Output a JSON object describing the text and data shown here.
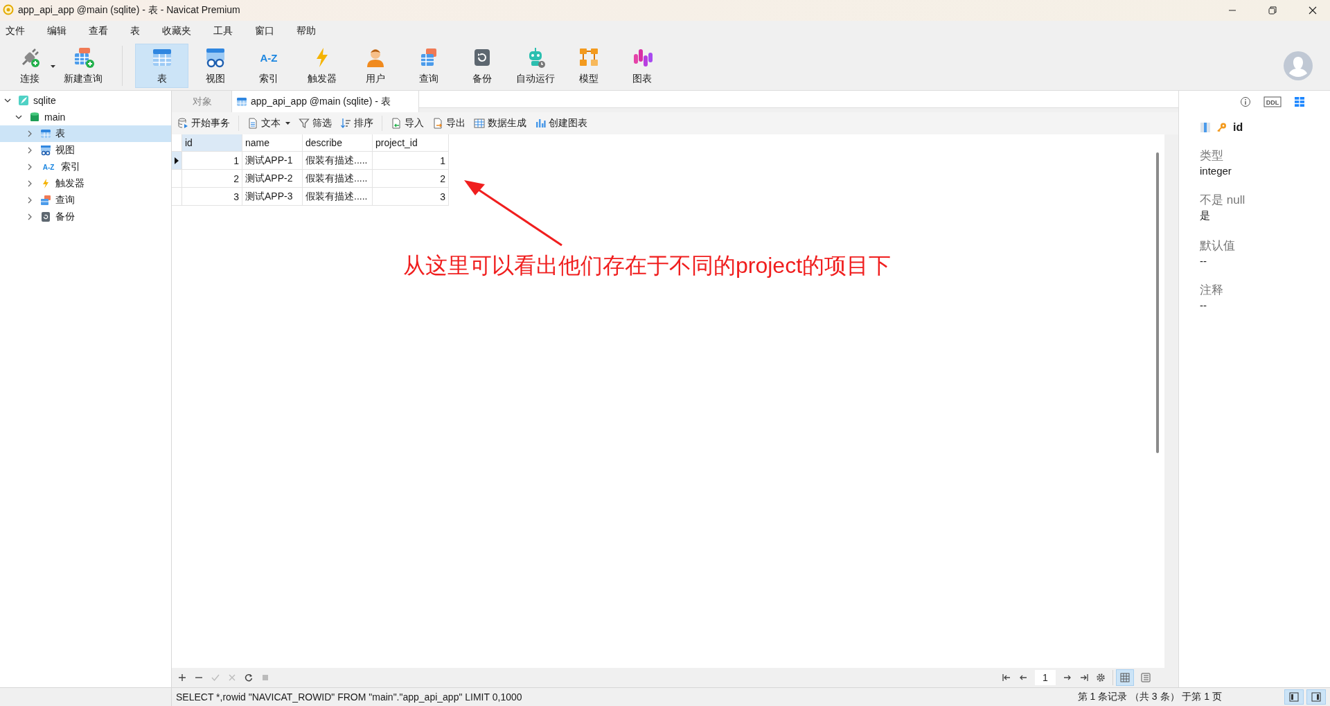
{
  "window": {
    "title": "app_api_app @main (sqlite) - 表 - Navicat Premium"
  },
  "menu": [
    "文件",
    "编辑",
    "查看",
    "表",
    "收藏夹",
    "工具",
    "窗口",
    "帮助"
  ],
  "toolbar": [
    {
      "label": "连接",
      "kind": "connect",
      "selected": false,
      "dropdown": true
    },
    {
      "label": "新建查询",
      "kind": "new-query",
      "selected": false,
      "dropdown": false
    },
    {
      "label": "表",
      "kind": "table",
      "selected": true,
      "dropdown": false
    },
    {
      "label": "视图",
      "kind": "view",
      "selected": false,
      "dropdown": false
    },
    {
      "label": "索引",
      "kind": "index",
      "selected": false,
      "dropdown": false,
      "icon_text": "A-Z"
    },
    {
      "label": "触发器",
      "kind": "trigger",
      "selected": false,
      "dropdown": false
    },
    {
      "label": "用户",
      "kind": "user",
      "selected": false,
      "dropdown": false
    },
    {
      "label": "查询",
      "kind": "query",
      "selected": false,
      "dropdown": false
    },
    {
      "label": "备份",
      "kind": "backup",
      "selected": false,
      "dropdown": false
    },
    {
      "label": "自动运行",
      "kind": "automation",
      "selected": false,
      "dropdown": false
    },
    {
      "label": "模型",
      "kind": "model",
      "selected": false,
      "dropdown": false
    },
    {
      "label": "图表",
      "kind": "chart",
      "selected": false,
      "dropdown": false
    }
  ],
  "tree": [
    {
      "label": "sqlite",
      "kind": "connection",
      "expanded": true,
      "selected": false,
      "children": [
        {
          "label": "main",
          "kind": "database",
          "expanded": true,
          "selected": false,
          "children": [
            {
              "label": "表",
              "kind": "table",
              "expanded": false,
              "selected": true
            },
            {
              "label": "视图",
              "kind": "view",
              "expanded": false,
              "selected": false
            },
            {
              "label": "索引",
              "kind": "index",
              "expanded": false,
              "selected": false,
              "icon_text": "A-Z"
            },
            {
              "label": "触发器",
              "kind": "trigger",
              "expanded": false,
              "selected": false
            },
            {
              "label": "查询",
              "kind": "query",
              "expanded": false,
              "selected": false
            },
            {
              "label": "备份",
              "kind": "backup",
              "expanded": false,
              "selected": false
            }
          ]
        }
      ]
    }
  ],
  "tabs": [
    {
      "label": "对象",
      "kind": "objects",
      "selected": false
    },
    {
      "label": "app_api_app @main (sqlite) - 表",
      "kind": "table",
      "selected": true
    }
  ],
  "grid_toolbar": [
    {
      "label": "开始事务",
      "kind": "transaction",
      "dropdown": false
    },
    {
      "label": "文本",
      "kind": "text",
      "dropdown": true
    },
    {
      "label": "筛选",
      "kind": "filter",
      "dropdown": false
    },
    {
      "label": "排序",
      "kind": "sort",
      "dropdown": false
    },
    {
      "label": "导入",
      "kind": "import",
      "dropdown": false
    },
    {
      "label": "导出",
      "kind": "export",
      "dropdown": false
    },
    {
      "label": "数据生成",
      "kind": "generate",
      "dropdown": false
    },
    {
      "label": "创建图表",
      "kind": "chart",
      "dropdown": false
    }
  ],
  "table": {
    "columns": [
      {
        "name": "id",
        "numeric": true,
        "selected": true
      },
      {
        "name": "name",
        "numeric": false,
        "selected": false
      },
      {
        "name": "describe",
        "numeric": false,
        "selected": false
      },
      {
        "name": "project_id",
        "numeric": true,
        "selected": false
      }
    ],
    "rows": [
      {
        "cells": [
          "1",
          "测试APP-1",
          "假装有描述.....",
          "1"
        ],
        "current": true
      },
      {
        "cells": [
          "2",
          "测试APP-2",
          "假装有描述.....",
          "2"
        ],
        "current": false
      },
      {
        "cells": [
          "3",
          "测试APP-3",
          "假装有描述.....",
          "3"
        ],
        "current": false
      }
    ]
  },
  "annotation": {
    "text": "从这里可以看出他们存在于不同的project的项目下"
  },
  "nav": {
    "page": "1",
    "views": [
      {
        "kind": "grid",
        "selected": true
      },
      {
        "kind": "form",
        "selected": false
      }
    ]
  },
  "side_panel": {
    "tabs": [
      {
        "kind": "info",
        "selected": false
      },
      {
        "kind": "ddl",
        "selected": false,
        "icon_text": "DDL"
      },
      {
        "kind": "fields",
        "selected": true
      }
    ],
    "field": "id",
    "properties": [
      {
        "label": "类型",
        "value": "integer"
      },
      {
        "label": "不是 null",
        "value": "是"
      },
      {
        "label": "默认值",
        "value": "--"
      },
      {
        "label": "注释",
        "value": "--"
      }
    ]
  },
  "status_bar": {
    "sql": "SELECT *,rowid \"NAVICAT_ROWID\" FROM \"main\".\"app_api_app\" LIMIT 0,1000",
    "record": "第 1 条记录 （共 3 条） 于第 1 页",
    "panels": [
      {
        "kind": "left",
        "selected": true
      },
      {
        "kind": "right",
        "selected": true
      }
    ]
  }
}
